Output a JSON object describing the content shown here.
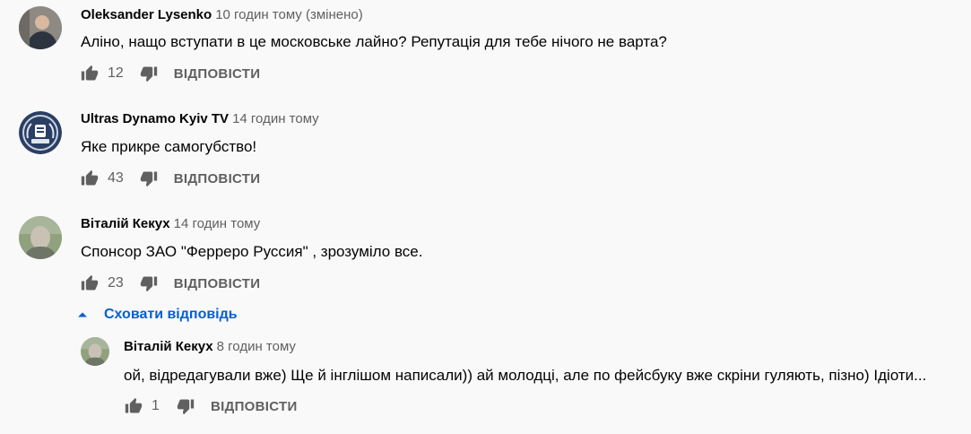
{
  "colors": {
    "link": "#065fd4",
    "secondary_text": "#606060",
    "background": "#f9f9f9"
  },
  "comments": [
    {
      "author": "Oleksander Lysenko",
      "time": "10 годин тому (змінено)",
      "text": "Аліно, нащо вступати в це московське лайно? Репутація для тебе нічого не варта?",
      "likes": "12",
      "reply_label": "ВІДПОВІСТИ"
    },
    {
      "author": "Ultras Dynamo Kyiv TV",
      "time": "14 годин тому",
      "text": "Яке прикре самогубство!",
      "likes": "43",
      "reply_label": "ВІДПОВІСТИ"
    },
    {
      "author": "Віталій Кекух",
      "time": "14 годин тому",
      "text": "Спонсор ЗАО \"Ферреро Руссия\" , зрозуміло все.",
      "likes": "23",
      "reply_label": "ВІДПОВІСТИ"
    }
  ],
  "replies_toggle": {
    "label": "Сховати відповідь",
    "icon": "caret-up-icon"
  },
  "reply": {
    "author": "Віталій Кекух",
    "time": "8 годин тому",
    "text": "ой, відредагували вже) Ще й інглішом написали)) ай молодці, але по фейсбуку вже скріни гуляють, пізно) Ідіоти...",
    "likes": "1",
    "reply_label": "ВІДПОВІСТИ"
  }
}
